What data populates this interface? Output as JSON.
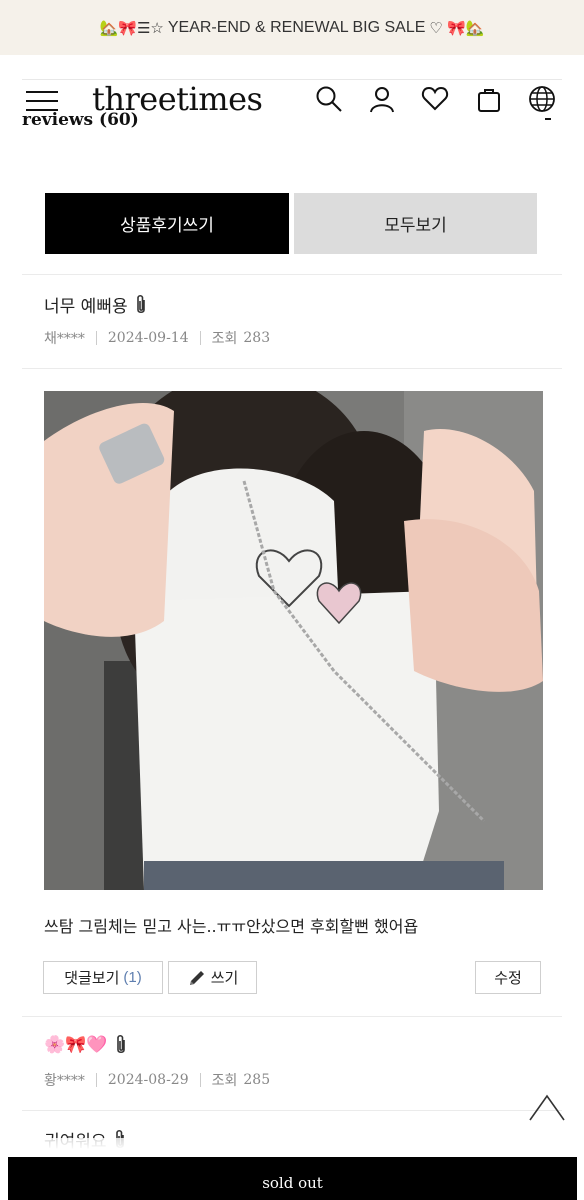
{
  "banner": {
    "prefix_emoji": "🏡🎀☰☆",
    "text": "YEAR-END & RENEWAL BIG SALE",
    "suffix_emoji": "♡ 🎀🏡"
  },
  "header": {
    "logo": "threetimes",
    "reviews_label": "reviews (60)",
    "icons": [
      "hamburger-menu-icon",
      "search-icon",
      "user-icon",
      "heart-icon",
      "cart-icon",
      "globe-icon"
    ]
  },
  "actions": {
    "write_review": "상품후기쓰기",
    "view_all": "모두보기"
  },
  "reviews": [
    {
      "title": "너무 예뻐용",
      "author": "채****",
      "date": "2024-09-14",
      "views_label": "조회",
      "views": "283",
      "body": "쓰탐 그림체는 믿고 사는..ㅠㅠ안샀으면 후회할뻔 했어욥",
      "comments_label": "댓글보기",
      "comments_count": "(1)",
      "write_label": "쓰기",
      "edit_label": "수정"
    },
    {
      "title": "🌸🎀🩷",
      "author": "황****",
      "date": "2024-08-29",
      "views_label": "조회",
      "views": "285"
    },
    {
      "title": "귀여워요"
    }
  ],
  "footer": {
    "sold_out": "sold out"
  },
  "colors": {
    "banner_bg": "#f5f1ea",
    "primary": "#000000",
    "secondary_btn": "#dcdcdc",
    "comment_count": "#5f7fb0"
  }
}
